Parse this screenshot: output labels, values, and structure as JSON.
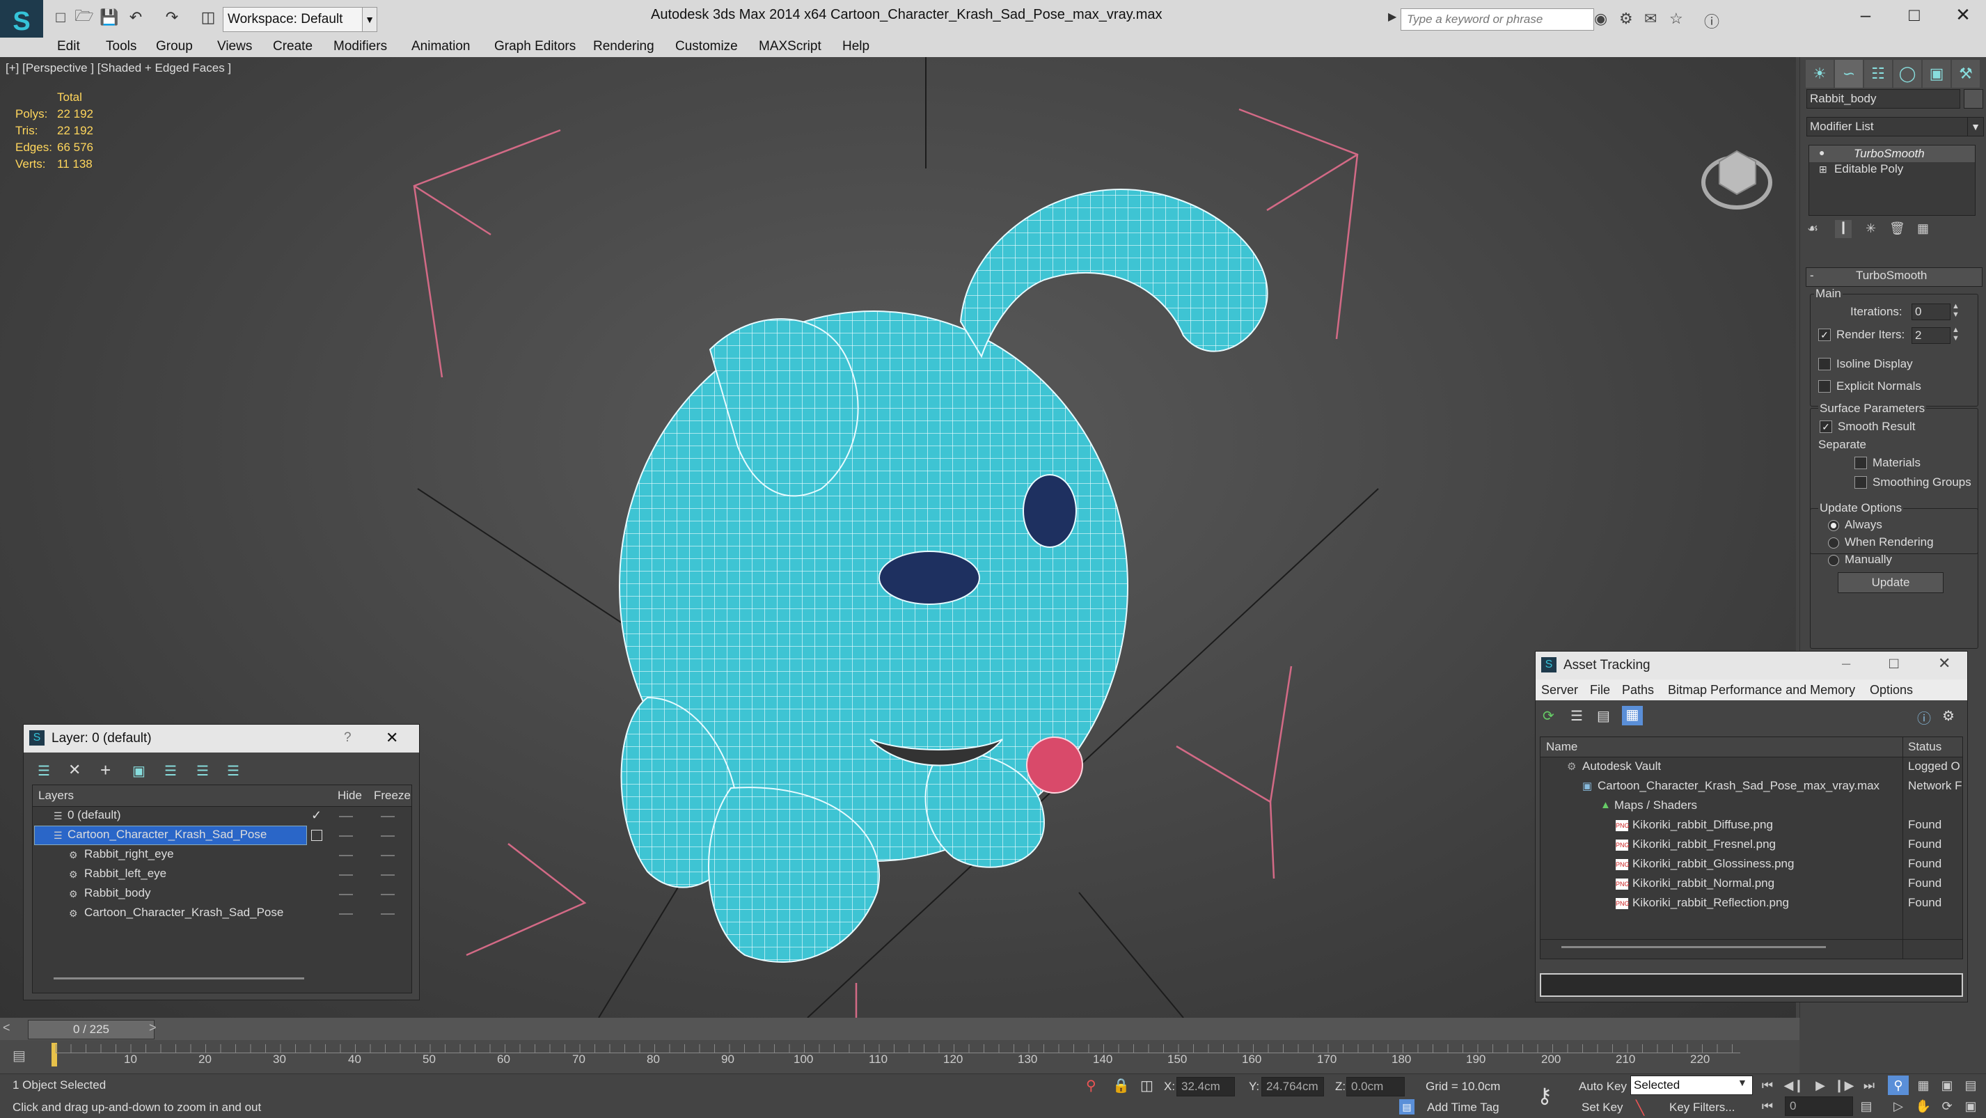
{
  "titlebar": {
    "workspace": "Workspace: Default",
    "app_title": "Autodesk 3ds Max  2014 x64",
    "file_title": "Cartoon_Character_Krash_Sad_Pose_max_vray.max",
    "search_placeholder": "Type a keyword or phrase"
  },
  "menubar": {
    "items": [
      "Edit",
      "Tools",
      "Group",
      "Views",
      "Create",
      "Modifiers",
      "Animation",
      "Graph Editors",
      "Rendering",
      "Customize",
      "MAXScript",
      "Help"
    ]
  },
  "viewport": {
    "label": "[+] [Perspective ] [Shaded + Edged Faces ]",
    "stats_header": "Total",
    "stats": [
      {
        "label": "Polys:",
        "value": "22 192"
      },
      {
        "label": "Tris:",
        "value": "22 192"
      },
      {
        "label": "Edges:",
        "value": "66 576"
      },
      {
        "label": "Verts:",
        "value": "11 138"
      }
    ]
  },
  "command_panel": {
    "object_name": "Rabbit_body",
    "modifier_list": "Modifier List",
    "stack": [
      "TurboSmooth",
      "Editable Poly"
    ],
    "rollout_title": "TurboSmooth",
    "main_label": "Main",
    "iterations_label": "Iterations:",
    "iterations_value": "0",
    "render_iters_label": "Render Iters:",
    "render_iters_value": "2",
    "isoline_label": "Isoline Display",
    "explicit_normals_label": "Explicit Normals",
    "surface_params_label": "Surface Parameters",
    "smooth_result_label": "Smooth Result",
    "separate_label": "Separate",
    "materials_label": "Materials",
    "smoothing_groups_label": "Smoothing Groups",
    "update_options_label": "Update Options",
    "always_label": "Always",
    "when_rendering_label": "When Rendering",
    "manually_label": "Manually",
    "update_button": "Update"
  },
  "layer_dialog": {
    "title": "Layer: 0 (default)",
    "help": "?",
    "col_layers": "Layers",
    "col_hide": "Hide",
    "col_freeze": "Freeze",
    "rows": [
      {
        "name": "0 (default)"
      },
      {
        "name": "Cartoon_Character_Krash_Sad_Pose"
      },
      {
        "name": "Rabbit_right_eye"
      },
      {
        "name": "Rabbit_left_eye"
      },
      {
        "name": "Rabbit_body"
      },
      {
        "name": "Cartoon_Character_Krash_Sad_Pose"
      }
    ]
  },
  "asset_dialog": {
    "title": "Asset Tracking",
    "menu": [
      "Server",
      "File",
      "Paths",
      "Bitmap Performance and Memory",
      "Options"
    ],
    "col_name": "Name",
    "col_status": "Status",
    "rows": [
      {
        "name": "Autodesk Vault",
        "status": "Logged O"
      },
      {
        "name": "Cartoon_Character_Krash_Sad_Pose_max_vray.max",
        "status": "Network F"
      },
      {
        "name": "Maps / Shaders",
        "status": ""
      },
      {
        "name": "Kikoriki_rabbit_Diffuse.png",
        "status": "Found"
      },
      {
        "name": "Kikoriki_rabbit_Fresnel.png",
        "status": "Found"
      },
      {
        "name": "Kikoriki_rabbit_Glossiness.png",
        "status": "Found"
      },
      {
        "name": "Kikoriki_rabbit_Normal.png",
        "status": "Found"
      },
      {
        "name": "Kikoriki_rabbit_Reflection.png",
        "status": "Found"
      }
    ]
  },
  "timeline": {
    "frame": "0 / 225",
    "ticks": [
      "10",
      "20",
      "30",
      "40",
      "50",
      "60",
      "70",
      "80",
      "90",
      "100",
      "110",
      "120",
      "130",
      "140",
      "150",
      "160",
      "170",
      "180",
      "190",
      "200",
      "210",
      "220"
    ]
  },
  "statusbar": {
    "selection": "1 Object Selected",
    "prompt": "Click and drag up-and-down to zoom in and out",
    "x_label": "X:",
    "x_value": "32.4cm",
    "y_label": "Y:",
    "y_value": "24.764cm",
    "z_label": "Z:",
    "z_value": "0.0cm",
    "grid": "Grid = 10.0cm",
    "auto_key": "Auto Key",
    "selected": "Selected",
    "set_key": "Set Key",
    "key_filters": "Key Filters...",
    "add_time_tag": "Add Time Tag",
    "frame_field": "0"
  }
}
